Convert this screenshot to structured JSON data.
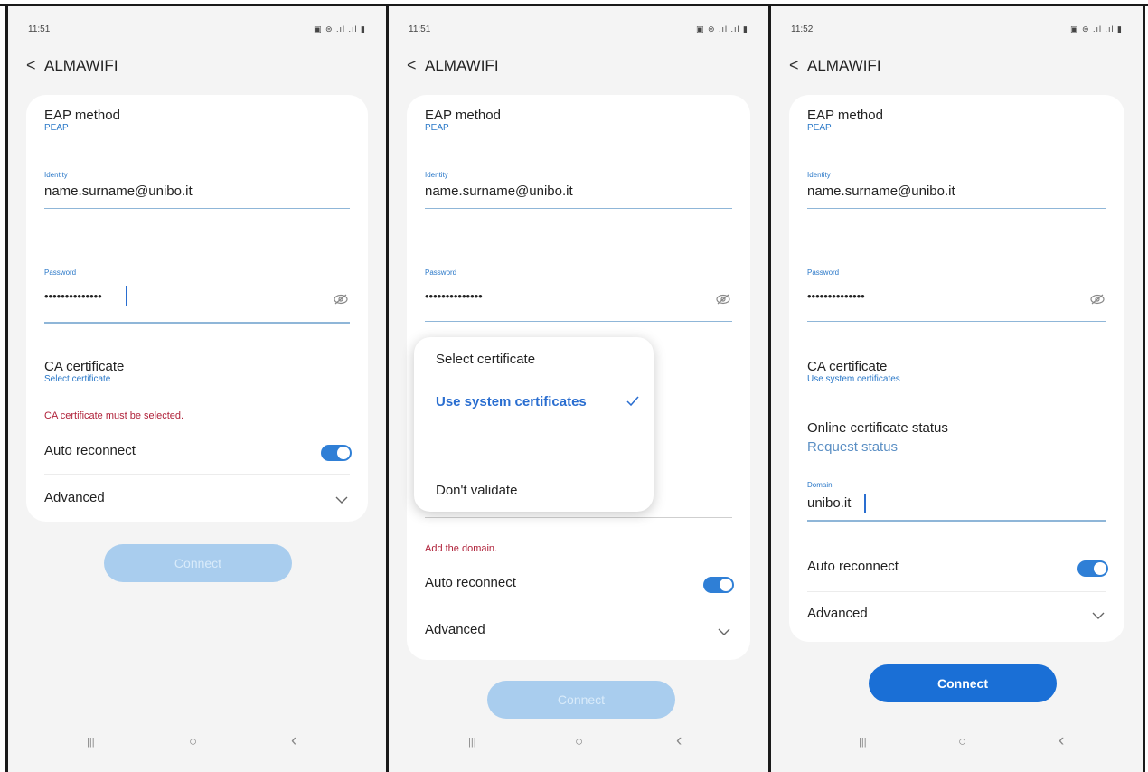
{
  "colors": {
    "accent": "#2a78c8",
    "button": "#1a6fd6",
    "error": "#b0223a",
    "toggle": "#2f7fd6"
  },
  "panels": [
    {
      "time": "11:51",
      "status_icons": "▣ ⊜ .ıl .ıl ▮",
      "network": "ALMAWIFI",
      "eap_label": "EAP method",
      "eap_value": "PEAP",
      "identity_label": "Identity",
      "identity_value": "name.surname@unibo.it",
      "password_label": "Password",
      "password_value": "••••••••••••••",
      "ca_label": "CA certificate",
      "ca_value": "Select certificate",
      "error": "CA certificate must be selected.",
      "auto_reconnect": "Auto reconnect",
      "advanced": "Advanced",
      "connect": "Connect"
    },
    {
      "time": "11:51",
      "status_icons": "▣ ⊜ .ıl .ıl ▮",
      "network": "ALMAWIFI",
      "eap_label": "EAP method",
      "eap_value": "PEAP",
      "identity_label": "Identity",
      "identity_value": "name.surname@unibo.it",
      "password_label": "Password",
      "password_value": "••••••••••••••",
      "popup_title": "Select certificate",
      "popup_option_selected": "Use system certificates",
      "popup_option_other": "Don't validate",
      "error": "Add the domain.",
      "auto_reconnect": "Auto reconnect",
      "advanced": "Advanced",
      "connect": "Connect"
    },
    {
      "time": "11:52",
      "status_icons": "▣ ⊜ .ıl .ıl ▮",
      "network": "ALMAWIFI",
      "eap_label": "EAP method",
      "eap_value": "PEAP",
      "identity_label": "Identity",
      "identity_value": "name.surname@unibo.it",
      "password_label": "Password",
      "password_value": "••••••••••••••",
      "ca_label": "CA certificate",
      "ca_value": "Use system certificates",
      "ocsp_label": "Online certificate status",
      "ocsp_value": "Request status",
      "domain_label": "Domain",
      "domain_value": "unibo.it",
      "auto_reconnect": "Auto reconnect",
      "advanced": "Advanced",
      "connect": "Connect"
    }
  ],
  "nav": {
    "recents": "|||",
    "home": "○",
    "back": "‹"
  }
}
